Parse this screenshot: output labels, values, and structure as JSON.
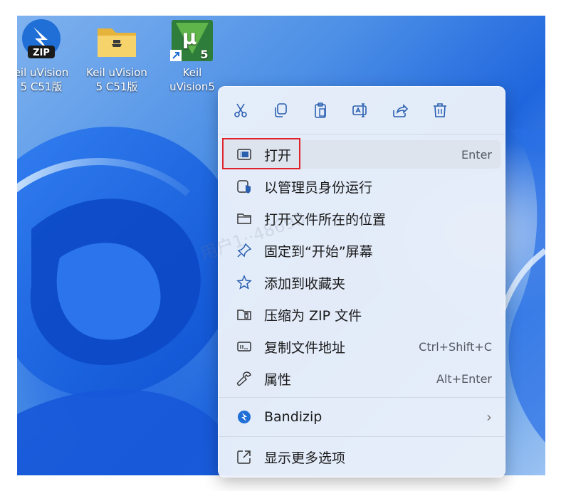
{
  "desktop": {
    "icons": [
      {
        "line1": "eil uVision",
        "line2": "5 C51版"
      },
      {
        "line1": "Keil uVision",
        "line2": "5 C51版"
      },
      {
        "line1": "Keil",
        "line2": "uVision5"
      }
    ],
    "zip_badge": "ZIP",
    "uv_glyph": "μ",
    "uv_version": "5"
  },
  "menu": {
    "toolbar": [
      {
        "icon": "cut-icon"
      },
      {
        "icon": "copy-icon"
      },
      {
        "icon": "paste-icon"
      },
      {
        "icon": "rename-icon"
      },
      {
        "icon": "share-icon"
      },
      {
        "icon": "delete-icon"
      }
    ],
    "items": [
      {
        "label": "打开",
        "shortcut": "Enter",
        "icon": "open-app-icon"
      },
      {
        "label": "以管理员身份运行",
        "shortcut": "",
        "icon": "admin-shield-icon"
      },
      {
        "label": "打开文件所在的位置",
        "shortcut": "",
        "icon": "folder-icon"
      },
      {
        "label": "固定到“开始”屏幕",
        "shortcut": "",
        "icon": "pin-icon"
      },
      {
        "label": "添加到收藏夹",
        "shortcut": "",
        "icon": "star-icon"
      },
      {
        "label": "压缩为 ZIP 文件",
        "shortcut": "",
        "icon": "zip-folder-icon"
      },
      {
        "label": "复制文件地址",
        "shortcut": "Ctrl+Shift+C",
        "icon": "copy-path-icon"
      },
      {
        "label": "属性",
        "shortcut": "Alt+Enter",
        "icon": "wrench-icon"
      }
    ],
    "bandizip": {
      "label": "Bandizip",
      "arrow": "›"
    },
    "more": {
      "label": "显示更多选项"
    }
  },
  "watermark": "用户1··48693",
  "colors": {
    "accent": "#2a5fb0",
    "highlight_border": "#e0232b",
    "menu_bg": "#e9f0fa"
  }
}
